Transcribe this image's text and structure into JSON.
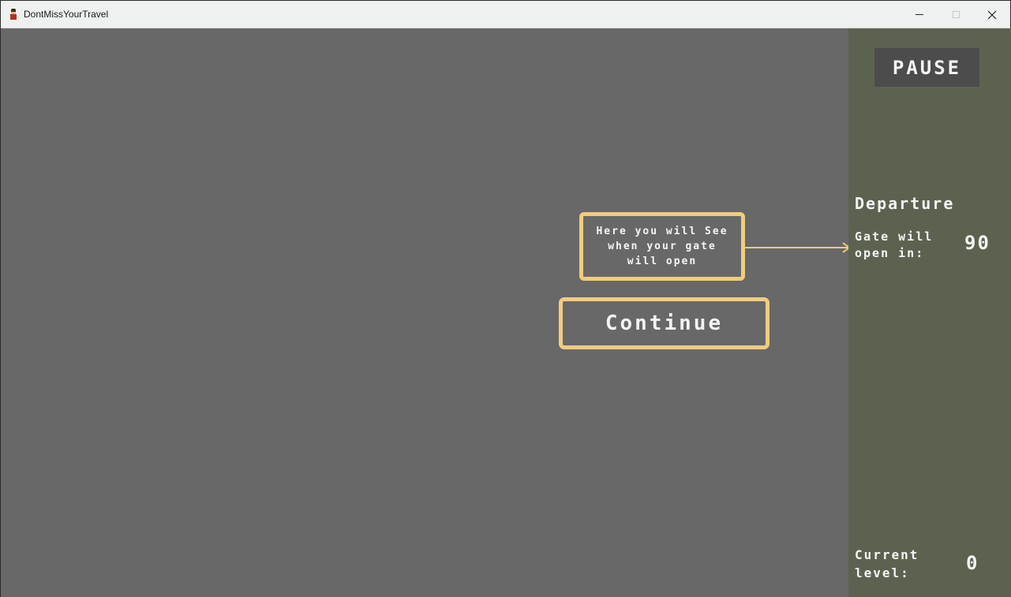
{
  "window": {
    "title": "DontMissYourTravel"
  },
  "tutorial": {
    "hint_text": "Here you will See when your gate will open",
    "continue_label": "Continue"
  },
  "sidebar": {
    "pause_label": "PAUSE",
    "departure_title": "Departure",
    "gate_label": "Gate will open in:",
    "gate_value": "90",
    "level_label": "Current level:",
    "level_value": "0"
  },
  "colors": {
    "game_background": "#686868",
    "sidebar_background": "#5c6250",
    "highlight_border": "#f0cd7c",
    "pause_button": "#4c4c4c"
  }
}
